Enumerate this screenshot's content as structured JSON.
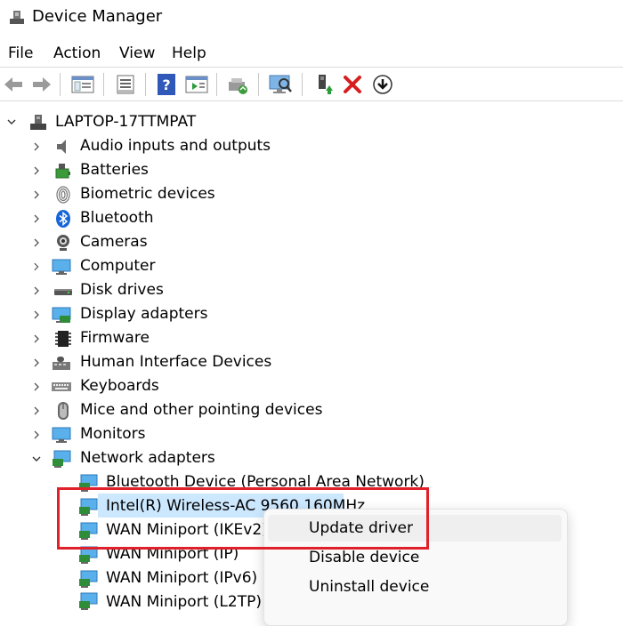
{
  "window": {
    "title": "Device Manager"
  },
  "menu": [
    "File",
    "Action",
    "View",
    "Help"
  ],
  "toolbar": {
    "icons": [
      "back-arrow-icon",
      "forward-arrow-icon",
      "show-hide-console-tree-icon",
      "properties-icon",
      "help-icon",
      "action-pane-icon",
      "update-driver-icon",
      "scan-hardware-icon",
      "enable-device-icon",
      "uninstall-device-icon",
      "download-icon"
    ]
  },
  "tree": {
    "root": "LAPTOP-17TTMPAT",
    "categories": [
      "Audio inputs and outputs",
      "Batteries",
      "Biometric devices",
      "Bluetooth",
      "Cameras",
      "Computer",
      "Disk drives",
      "Display adapters",
      "Firmware",
      "Human Interface Devices",
      "Keyboards",
      "Mice and other pointing devices",
      "Monitors",
      "Network adapters"
    ],
    "network_children": [
      "Bluetooth Device (Personal Area Network)",
      "Intel(R) Wireless-AC 9560 160MHz",
      "WAN Miniport (IKEv2)",
      "WAN Miniport (IP)",
      "WAN Miniport (IPv6)",
      "WAN Miniport (L2TP)"
    ]
  },
  "context_menu": {
    "items": [
      "Update driver",
      "Disable device",
      "Uninstall device"
    ]
  },
  "colors": {
    "selection": "#cce8ff",
    "highlight_border": "#e0202a",
    "accent": "#0a7bd6"
  }
}
